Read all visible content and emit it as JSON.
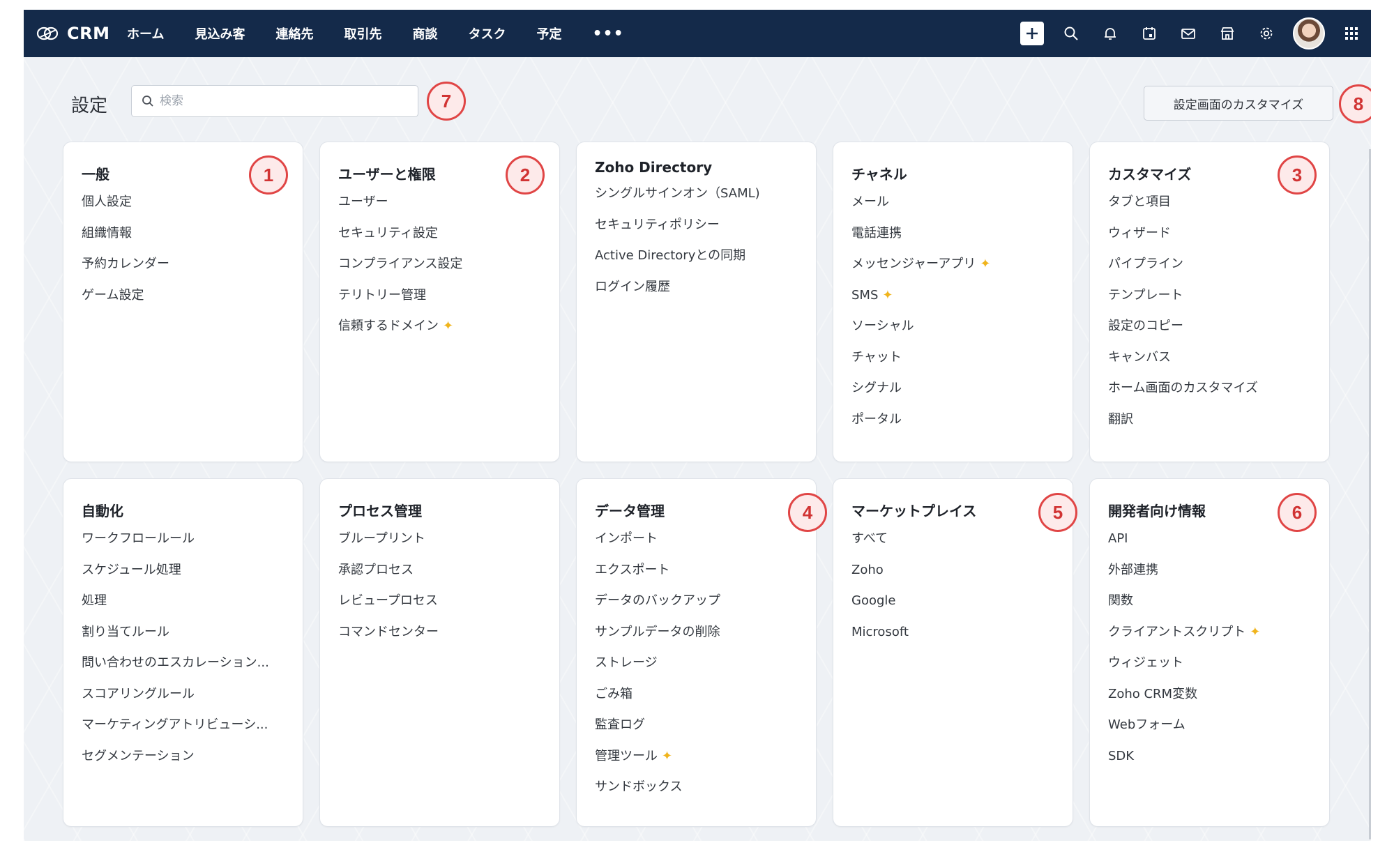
{
  "brand": {
    "name": "CRM"
  },
  "nav": [
    {
      "label": "ホーム"
    },
    {
      "label": "見込み客"
    },
    {
      "label": "連絡先"
    },
    {
      "label": "取引先"
    },
    {
      "label": "商談"
    },
    {
      "label": "タスク"
    },
    {
      "label": "予定"
    }
  ],
  "nav_more": "•••",
  "top_icons": [
    "plus-icon",
    "search-icon",
    "bell-icon",
    "calendar-icon",
    "mail-icon",
    "store-icon",
    "gear-icon",
    "avatar",
    "apps-grid-icon"
  ],
  "settings": {
    "title": "設定",
    "search_placeholder": "検索",
    "customize_label": "設定画面のカスタマイズ"
  },
  "badges": [
    "1",
    "2",
    "3",
    "4",
    "5",
    "6",
    "7",
    "8"
  ],
  "colors": {
    "nav_bg": "#142a4a",
    "badge": "#e04545",
    "sparkle": "#f0b41c"
  },
  "cards": [
    {
      "title": "一般",
      "items": [
        {
          "label": "個人設定"
        },
        {
          "label": "組織情報"
        },
        {
          "label": "予約カレンダー"
        },
        {
          "label": "ゲーム設定"
        }
      ]
    },
    {
      "title": "ユーザーと権限",
      "items": [
        {
          "label": "ユーザー"
        },
        {
          "label": "セキュリティ設定"
        },
        {
          "label": "コンプライアンス設定"
        },
        {
          "label": "テリトリー管理"
        },
        {
          "label": "信頼するドメイン",
          "sparkle": true
        }
      ]
    },
    {
      "title": "Zoho Directory",
      "items": [
        {
          "label": "シングルサインオン（SAML)"
        },
        {
          "label": "セキュリティポリシー"
        },
        {
          "label": "Active Directoryとの同期"
        },
        {
          "label": "ログイン履歴"
        }
      ]
    },
    {
      "title": "チャネル",
      "items": [
        {
          "label": "メール"
        },
        {
          "label": "電話連携"
        },
        {
          "label": "メッセンジャーアプリ",
          "sparkle": true
        },
        {
          "label": "SMS",
          "sparkle": true
        },
        {
          "label": "ソーシャル"
        },
        {
          "label": "チャット"
        },
        {
          "label": "シグナル"
        },
        {
          "label": "ポータル"
        }
      ]
    },
    {
      "title": "カスタマイズ",
      "items": [
        {
          "label": "タブと項目"
        },
        {
          "label": "ウィザード"
        },
        {
          "label": "パイプライン"
        },
        {
          "label": "テンプレート"
        },
        {
          "label": "設定のコピー"
        },
        {
          "label": "キャンバス"
        },
        {
          "label": "ホーム画面のカスタマイズ"
        },
        {
          "label": "翻訳"
        }
      ]
    },
    {
      "title": "自動化",
      "items": [
        {
          "label": "ワークフロールール"
        },
        {
          "label": "スケジュール処理"
        },
        {
          "label": "処理"
        },
        {
          "label": "割り当てルール"
        },
        {
          "label": "問い合わせのエスカレーション..."
        },
        {
          "label": "スコアリングルール"
        },
        {
          "label": "マーケティングアトリビューシ..."
        },
        {
          "label": "セグメンテーション"
        }
      ]
    },
    {
      "title": "プロセス管理",
      "items": [
        {
          "label": "ブループリント"
        },
        {
          "label": "承認プロセス"
        },
        {
          "label": "レビュープロセス"
        },
        {
          "label": "コマンドセンター"
        }
      ]
    },
    {
      "title": "データ管理",
      "items": [
        {
          "label": "インポート"
        },
        {
          "label": "エクスポート"
        },
        {
          "label": "データのバックアップ"
        },
        {
          "label": "サンプルデータの削除"
        },
        {
          "label": "ストレージ"
        },
        {
          "label": "ごみ箱"
        },
        {
          "label": "監査ログ"
        },
        {
          "label": "管理ツール",
          "sparkle": true
        },
        {
          "label": "サンドボックス"
        }
      ]
    },
    {
      "title": "マーケットプレイス",
      "items": [
        {
          "label": "すべて"
        },
        {
          "label": "Zoho"
        },
        {
          "label": "Google"
        },
        {
          "label": "Microsoft"
        }
      ]
    },
    {
      "title": "開発者向け情報",
      "items": [
        {
          "label": "API"
        },
        {
          "label": "外部連携"
        },
        {
          "label": "関数"
        },
        {
          "label": "クライアントスクリプト",
          "sparkle": true
        },
        {
          "label": "ウィジェット"
        },
        {
          "label": "Zoho CRM変数"
        },
        {
          "label": "Webフォーム"
        },
        {
          "label": "SDK"
        }
      ]
    }
  ]
}
